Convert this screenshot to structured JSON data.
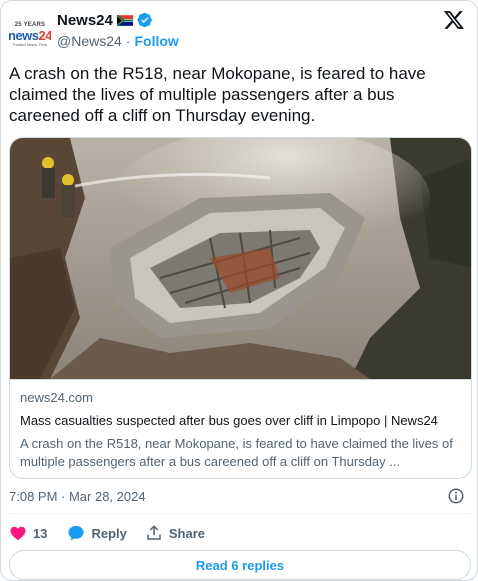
{
  "author": {
    "display_name": "News24",
    "handle": "@News24",
    "separator": "·",
    "follow_label": "Follow",
    "avatar": {
      "years_text": "25 YEARS",
      "logo_part1": "news",
      "logo_part2": "24",
      "tagline": "Trusted News. First."
    }
  },
  "tweet": {
    "text": "A crash on the R518, near Mokopane, is feared to have claimed the lives of multiple passengers after a bus careened off a cliff on Thursday evening."
  },
  "link_card": {
    "domain": "news24.com",
    "title": "Mass casualties suspected after bus goes over cliff in Limpopo | News24",
    "description": "A crash on the R518, near Mokopane, is feared to have claimed the lives of multiple passengers after a bus careened off a cliff on Thursday ..."
  },
  "meta": {
    "timestamp": "7:08 PM · Mar 28, 2024"
  },
  "actions": {
    "like_count": "13",
    "reply_label": "Reply",
    "share_label": "Share"
  },
  "read_replies_label": "Read 6 replies",
  "colors": {
    "accent": "#1d9bf0",
    "like": "#f91880",
    "secondary_text": "#536471",
    "border": "#cfd9de"
  },
  "icons": [
    "x-logo-icon",
    "verified-badge-icon",
    "south-africa-flag-icon",
    "info-icon",
    "heart-icon",
    "reply-icon",
    "share-icon"
  ]
}
